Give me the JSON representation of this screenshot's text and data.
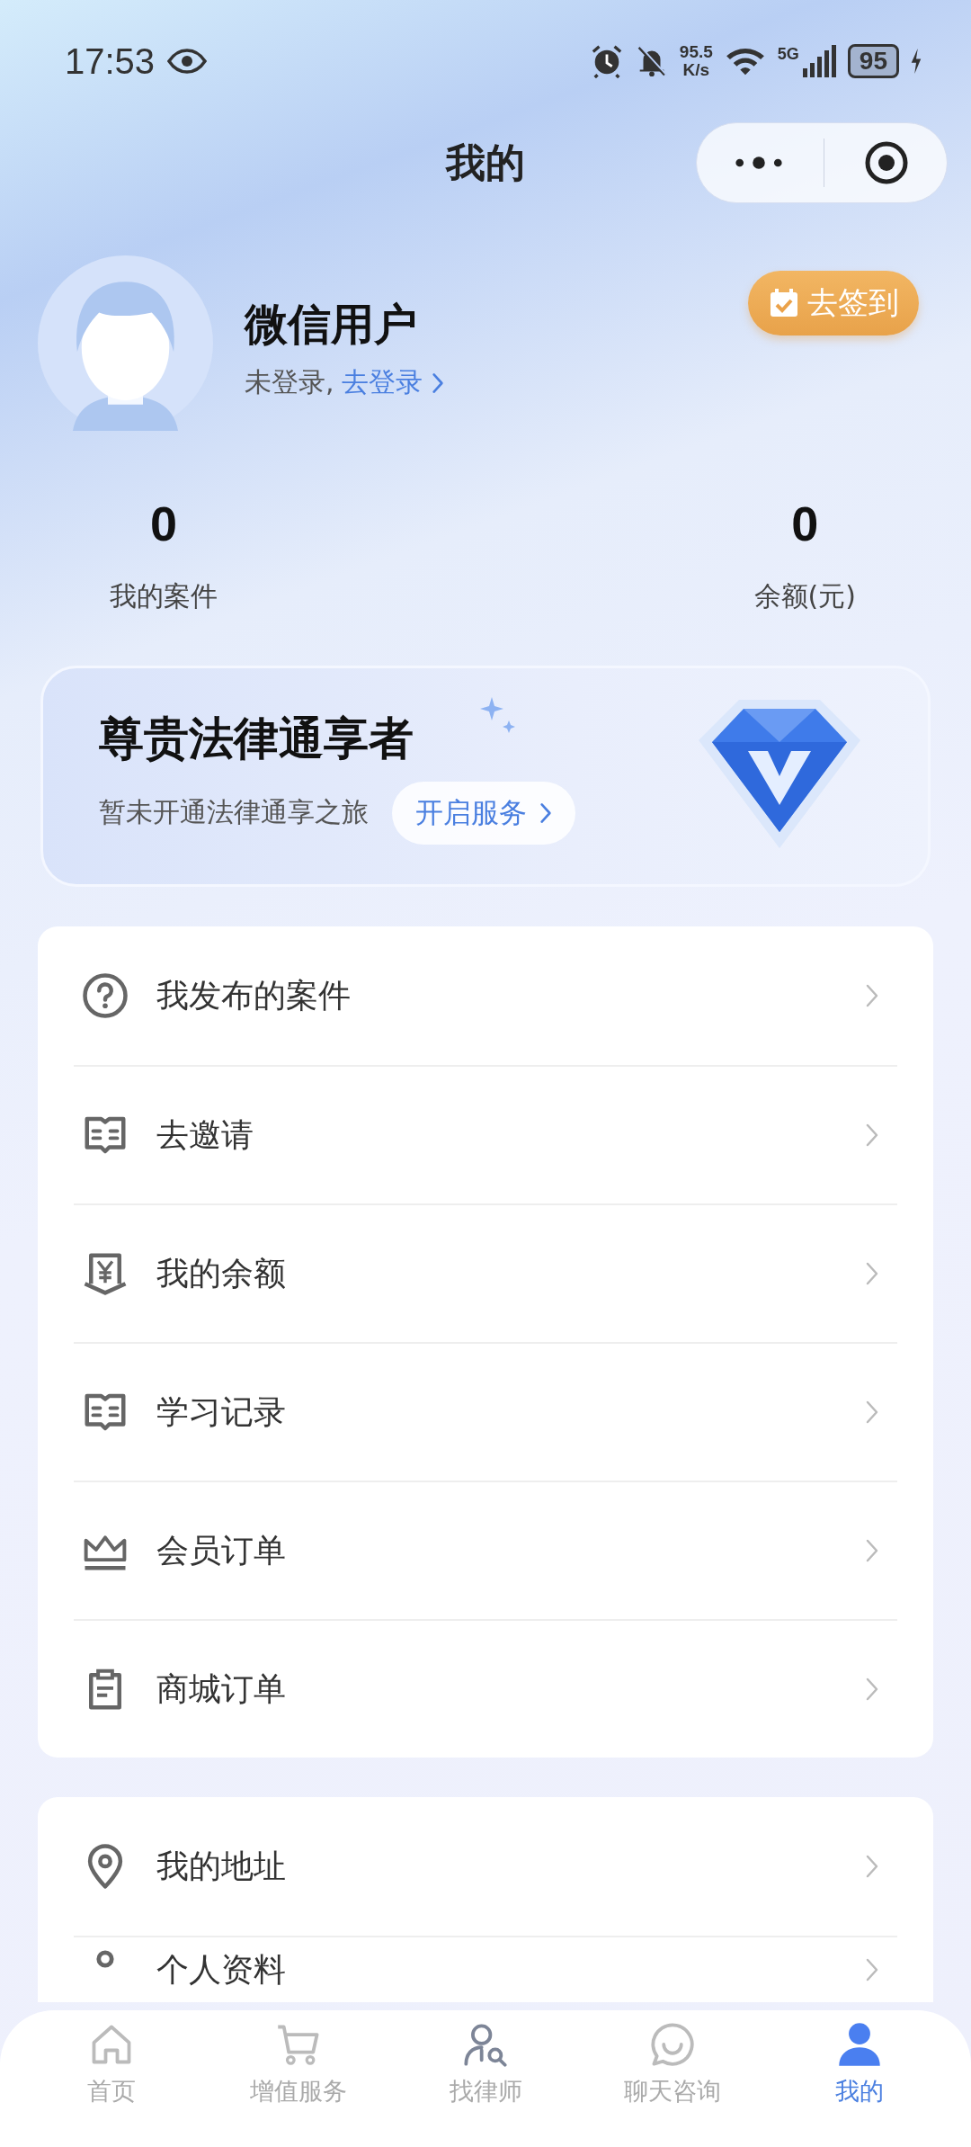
{
  "status_bar": {
    "time": "17:53",
    "net_speed": "95.5",
    "net_unit": "K/s",
    "network": "5G",
    "battery": "95",
    "charging": true
  },
  "title": "我的",
  "profile": {
    "name": "微信用户",
    "login_status": "未登录,",
    "login_link": "去登录",
    "sign_in": "去签到"
  },
  "stats": [
    {
      "value": "0",
      "label": "我的案件"
    },
    {
      "value": "0",
      "label": "余额(元)"
    }
  ],
  "vip": {
    "title": "尊贵法律通享者",
    "subtitle": "暂未开通法律通享之旅",
    "button": "开启服务"
  },
  "menu_groups": [
    [
      {
        "label": "我发布的案件"
      },
      {
        "label": "去邀请"
      },
      {
        "label": "我的余额"
      },
      {
        "label": "学习记录"
      },
      {
        "label": "会员订单"
      },
      {
        "label": "商城订单"
      }
    ],
    [
      {
        "label": "我的地址"
      },
      {
        "label": "个人资料"
      }
    ]
  ],
  "tabs": [
    {
      "label": "首页",
      "selected": false
    },
    {
      "label": "增值服务",
      "selected": false
    },
    {
      "label": "找律师",
      "selected": false
    },
    {
      "label": "聊天咨询",
      "selected": false
    },
    {
      "label": "我的",
      "selected": true
    }
  ]
}
